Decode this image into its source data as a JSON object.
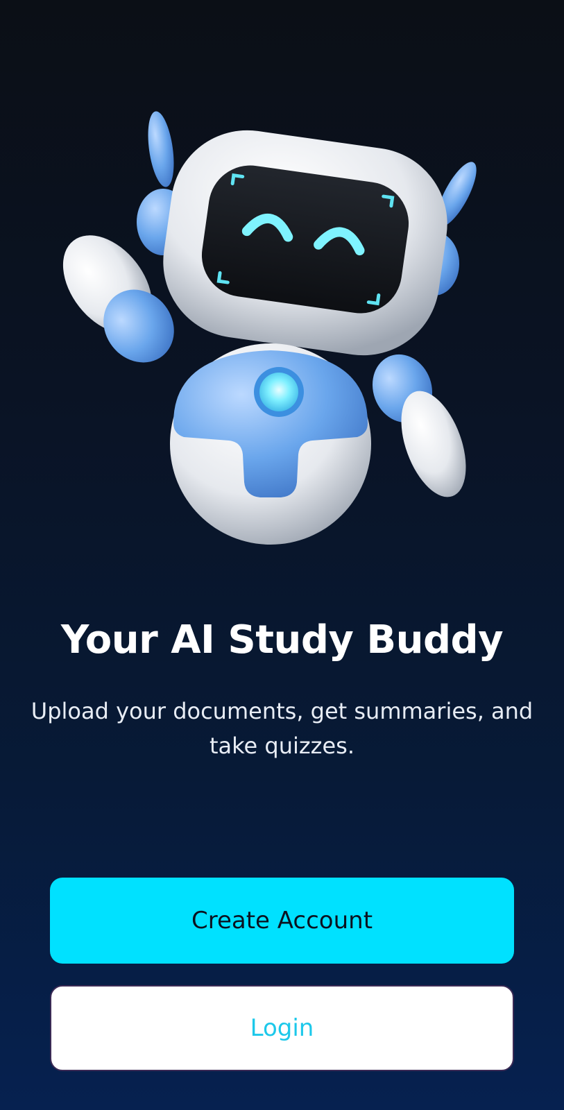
{
  "hero": {
    "title": "Your AI Study Buddy",
    "subtitle": "Upload your documents, get summaries, and take quizzes."
  },
  "actions": {
    "create_account_label": "Create Account",
    "login_label": "Login"
  },
  "colors": {
    "accent": "#00e1ff",
    "login_text": "#1cc8ea",
    "background_top": "#0b0f16",
    "background_bottom": "#062150"
  },
  "illustration": {
    "icon": "robot-mascot-icon"
  }
}
